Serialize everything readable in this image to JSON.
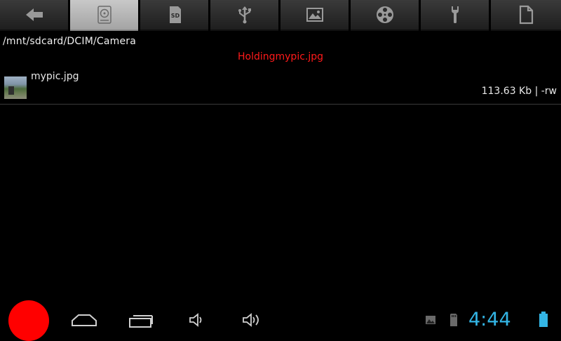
{
  "toolbar": {
    "buttons": [
      {
        "icon": "back-arrow-icon",
        "active": false
      },
      {
        "icon": "internal-storage-icon",
        "active": true
      },
      {
        "icon": "sd-card-icon",
        "active": false
      },
      {
        "icon": "usb-icon",
        "active": false
      },
      {
        "icon": "picture-icon",
        "active": false
      },
      {
        "icon": "film-reel-icon",
        "active": false
      },
      {
        "icon": "wrench-icon",
        "active": false
      },
      {
        "icon": "document-icon",
        "active": false
      }
    ],
    "sd_label": "SD"
  },
  "path": "/mnt/sdcard/DCIM/Camera",
  "holding_text": "Holdingmypic.jpg",
  "files": [
    {
      "name": "mypic.jpg",
      "size": "113.63 Kb",
      "perms": " | -rw"
    }
  ],
  "statusbar": {
    "time": "4:44"
  },
  "colors": {
    "accent": "#33b5e5",
    "holding": "#ff1a1a",
    "record": "#ff0000"
  }
}
